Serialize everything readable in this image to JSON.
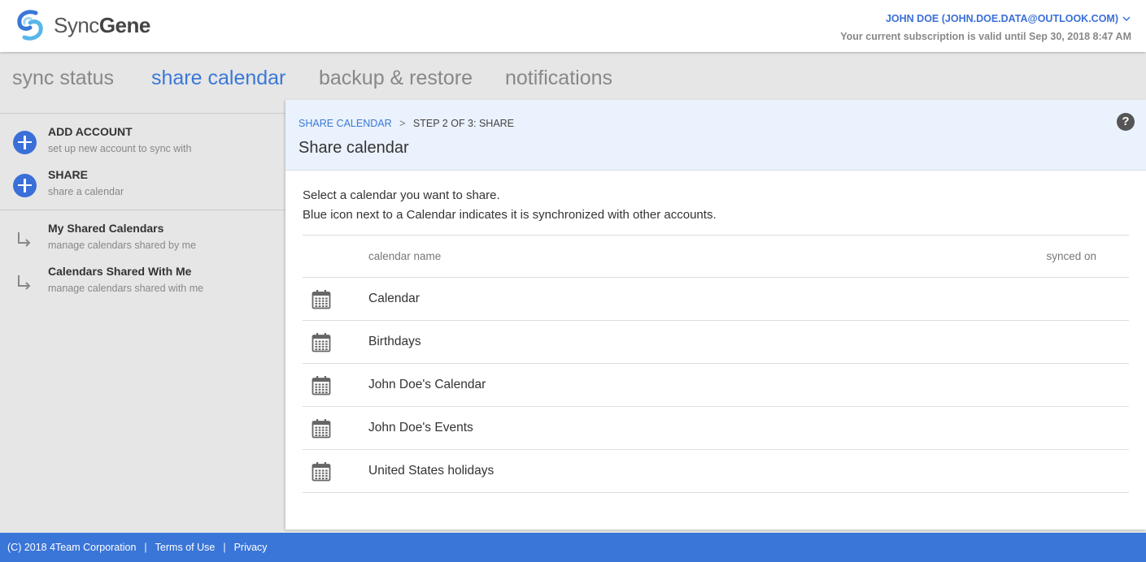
{
  "header": {
    "logo_text_light": "Sync",
    "logo_text_bold": "Gene",
    "user_label": "JOHN DOE (JOHN.DOE.DATA@OUTLOOK.COM)",
    "subscription": "Your current subscription is valid until Sep 30, 2018 8:47 AM",
    "colors": {
      "accent": "#3a78d8",
      "footer": "#3a75d8"
    }
  },
  "nav": {
    "tabs": [
      {
        "label": "sync status",
        "active": false
      },
      {
        "label": "share calendar",
        "active": true
      },
      {
        "label": "backup & restore",
        "active": false
      },
      {
        "label": "notifications",
        "active": false
      }
    ]
  },
  "sidebar": {
    "items": [
      {
        "title": "ADD ACCOUNT",
        "subtitle": "set up new account to sync with",
        "icon": "plus-circle-icon"
      },
      {
        "title": "SHARE",
        "subtitle": "share a calendar",
        "icon": "plus-circle-icon"
      },
      {
        "title": "My Shared Calendars",
        "subtitle": "manage calendars shared by me",
        "icon": "arrow-down-right-icon"
      },
      {
        "title": "Calendars Shared With Me",
        "subtitle": "manage calendars shared with me",
        "icon": "arrow-down-right-icon"
      }
    ]
  },
  "main": {
    "breadcrumb": {
      "link": "SHARE CALENDAR",
      "separator": ">",
      "current": "STEP 2 OF 3: SHARE"
    },
    "title": "Share calendar",
    "help_icon": "?",
    "intro_line1": "Select a calendar you want to share.",
    "intro_line2": "Blue icon next to a Calendar indicates it is synchronized with other accounts.",
    "table": {
      "col_name": "calendar name",
      "col_synced": "synced on",
      "rows": [
        {
          "name": "Calendar",
          "icon": "calendar-icon"
        },
        {
          "name": "Birthdays",
          "icon": "calendar-icon"
        },
        {
          "name": "John Doe's Calendar",
          "icon": "calendar-icon"
        },
        {
          "name": "John Doe's Events",
          "icon": "calendar-icon"
        },
        {
          "name": "United States holidays",
          "icon": "calendar-icon"
        }
      ]
    }
  },
  "footer": {
    "copyright": "(C) 2018  4Team Corporation",
    "separator": "|",
    "terms": "Terms of Use",
    "privacy": "Privacy"
  }
}
